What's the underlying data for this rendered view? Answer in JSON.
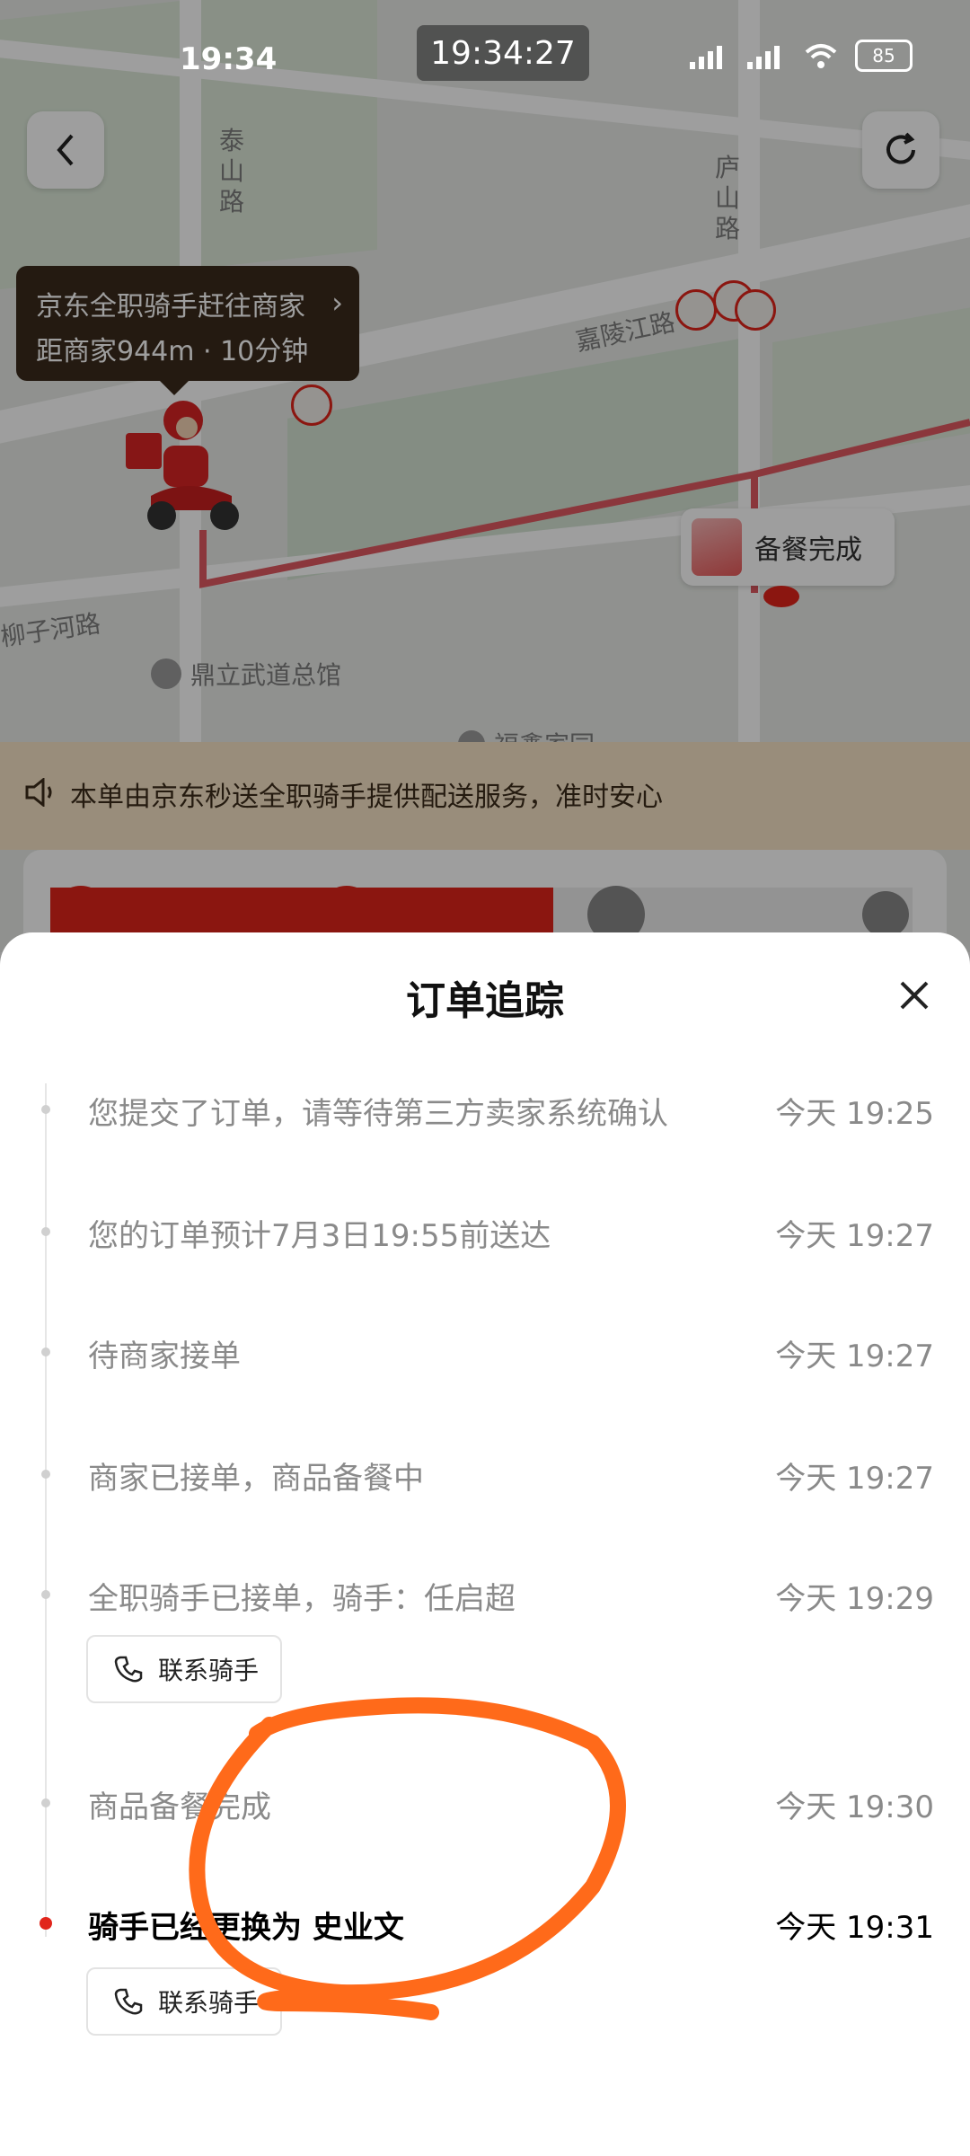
{
  "status_bar": {
    "time": "19:34",
    "center_time": "19:34:27",
    "battery": "85"
  },
  "map": {
    "roads": [
      "泰山路",
      "庐山路",
      "嘉陵江路",
      "柳子河路"
    ],
    "poi": [
      "鼎立武道总馆",
      "福鑫家园"
    ],
    "rider_bubble": {
      "line1": "京东全职骑手赶往商家",
      "line2": "距商家944m · 10分钟"
    },
    "shop_chip": "备餐完成"
  },
  "notice": {
    "text": "本单由京东秒送全职骑手提供配送服务，准时安心"
  },
  "sheet": {
    "title": "订单追踪",
    "contact_label": "联系骑手",
    "items": [
      {
        "text": "您提交了订单，请等待第三方卖家系统确认",
        "time": "今天 19:25"
      },
      {
        "text": "您的订单预计7月3日19:55前送达",
        "time": "今天 19:27"
      },
      {
        "text": "待商家接单",
        "time": "今天 19:27"
      },
      {
        "text": "商家已接单，商品备餐中",
        "time": "今天 19:27"
      },
      {
        "text": "全职骑手已接单，骑手：任启超",
        "time": "今天 19:29"
      },
      {
        "text": "商品备餐完成",
        "time": "今天 19:30"
      },
      {
        "text": "骑手已经更换为 史业文",
        "time": "今天 19:31"
      }
    ]
  },
  "colors": {
    "accent": "#e1251b",
    "annotation": "#ff6a1a"
  }
}
